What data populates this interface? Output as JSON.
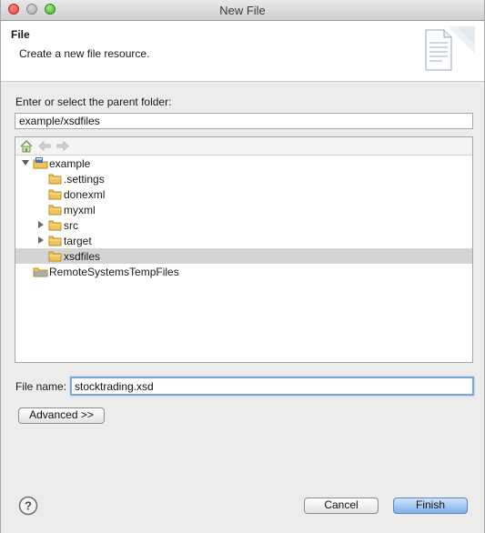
{
  "window": {
    "title": "New File"
  },
  "header": {
    "title": "File",
    "description": "Create a new file resource."
  },
  "parent_folder": {
    "label": "Enter or select the parent folder:",
    "value": "example/xsdfiles"
  },
  "tree": {
    "toolbar": [
      "home-icon",
      "back-arrow-icon",
      "forward-arrow-icon"
    ],
    "items": [
      {
        "label": "example",
        "type": "project",
        "expanded": true,
        "depth": 0
      },
      {
        "label": ".settings",
        "type": "folder",
        "depth": 1
      },
      {
        "label": "donexml",
        "type": "folder",
        "depth": 1
      },
      {
        "label": "myxml",
        "type": "folder",
        "depth": 1
      },
      {
        "label": "src",
        "type": "folder",
        "collapsed": true,
        "depth": 1
      },
      {
        "label": "target",
        "type": "folder",
        "collapsed": true,
        "depth": 1
      },
      {
        "label": "xsdfiles",
        "type": "folder",
        "selected": true,
        "depth": 1
      },
      {
        "label": "RemoteSystemsTempFiles",
        "type": "project",
        "depth": 0
      }
    ]
  },
  "file_name": {
    "label": "File name:",
    "value": "stocktrading.xsd"
  },
  "buttons": {
    "advanced": "Advanced >>",
    "cancel": "Cancel",
    "finish": "Finish"
  },
  "colors": {
    "selection": "#d4d4d4",
    "folder": "#f3c25a",
    "focus": "#7aa7d8",
    "finish_button": "#7fb1ea"
  }
}
